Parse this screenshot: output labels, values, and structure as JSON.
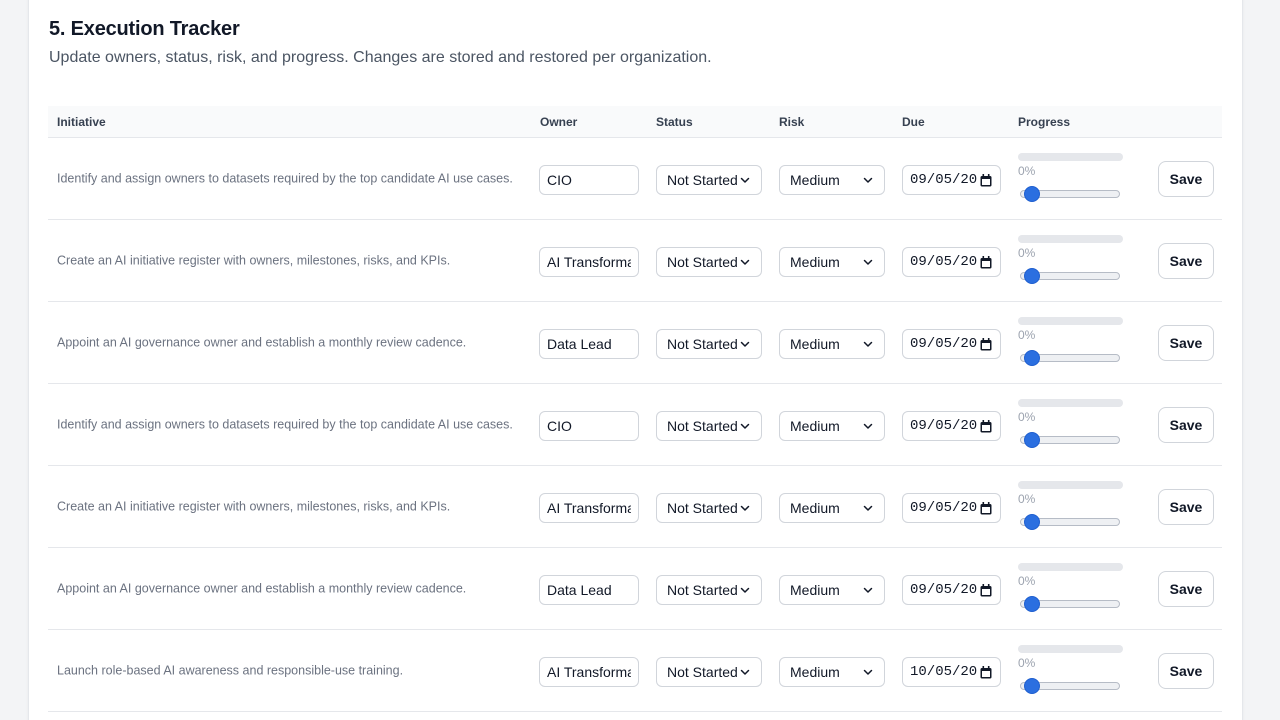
{
  "section": {
    "title": "5. Execution Tracker",
    "subtitle": "Update owners, status, risk, and progress. Changes are stored and restored per organization."
  },
  "columns": {
    "initiative": "Initiative",
    "owner": "Owner",
    "status": "Status",
    "risk": "Risk",
    "due": "Due",
    "progress": "Progress"
  },
  "rows": [
    {
      "initiative": "Identify and assign owners to datasets required by the top candidate AI use cases.",
      "owner": "CIO",
      "status": "Not Started",
      "risk": "Medium",
      "due": "09/05/20",
      "progress_label": "0%",
      "progress": 0,
      "save_label": "Save"
    },
    {
      "initiative": "Create an AI initiative register with owners, milestones, risks, and KPIs.",
      "owner": "AI Transformation",
      "status": "Not Started",
      "risk": "Medium",
      "due": "09/05/20",
      "progress_label": "0%",
      "progress": 0,
      "save_label": "Save"
    },
    {
      "initiative": "Appoint an AI governance owner and establish a monthly review cadence.",
      "owner": "Data Lead",
      "status": "Not Started",
      "risk": "Medium",
      "due": "09/05/20",
      "progress_label": "0%",
      "progress": 0,
      "save_label": "Save"
    },
    {
      "initiative": "Identify and assign owners to datasets required by the top candidate AI use cases.",
      "owner": "CIO",
      "status": "Not Started",
      "risk": "Medium",
      "due": "09/05/20",
      "progress_label": "0%",
      "progress": 0,
      "save_label": "Save"
    },
    {
      "initiative": "Create an AI initiative register with owners, milestones, risks, and KPIs.",
      "owner": "AI Transformation",
      "status": "Not Started",
      "risk": "Medium",
      "due": "09/05/20",
      "progress_label": "0%",
      "progress": 0,
      "save_label": "Save"
    },
    {
      "initiative": "Appoint an AI governance owner and establish a monthly review cadence.",
      "owner": "Data Lead",
      "status": "Not Started",
      "risk": "Medium",
      "due": "09/05/20",
      "progress_label": "0%",
      "progress": 0,
      "save_label": "Save"
    },
    {
      "initiative": "Launch role-based AI awareness and responsible-use training.",
      "owner": "AI Transformation",
      "status": "Not Started",
      "risk": "Medium",
      "due": "10/05/20",
      "progress_label": "0%",
      "progress": 0,
      "save_label": "Save"
    }
  ],
  "icons": {
    "select": "chevron-down-icon",
    "date": "calendar-icon"
  },
  "colors": {
    "accent": "#2563eb",
    "slider_thumb": "#2b6fe0"
  }
}
